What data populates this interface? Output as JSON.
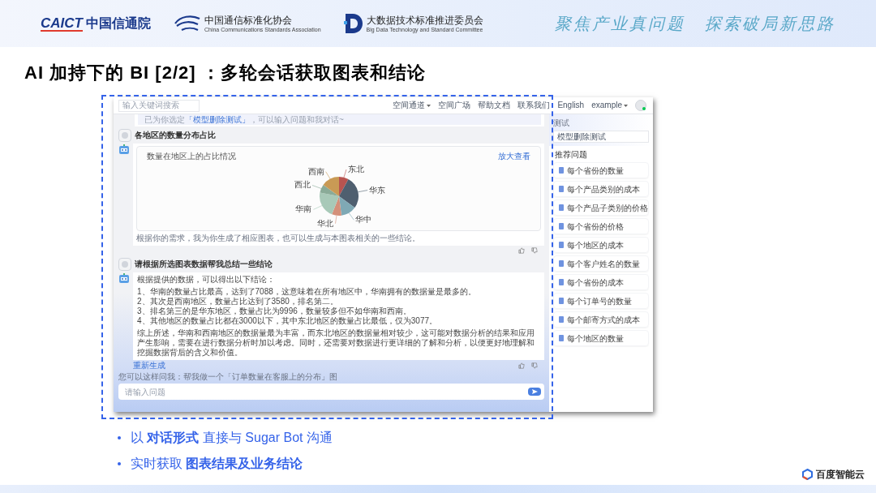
{
  "header": {
    "caict": {
      "mark": "CAICT",
      "name": "中国信通院"
    },
    "ccsa": {
      "name": "中国通信标准化协会",
      "english": "China Communications Standards Association"
    },
    "bdc": {
      "name": "大数据技术标准推进委员会",
      "english": "Big Data Technology and Standard Committee"
    },
    "slogan": [
      "聚焦产业真问题",
      "探索破局新思路"
    ]
  },
  "title": "AI 加持下的 BI [2/2] ：多轮会话获取图表和结论",
  "app": {
    "search": {
      "placeholder": "输入关键词搜索"
    },
    "nav": [
      {
        "label": "空间通道",
        "dropdown": true
      },
      {
        "label": "空间广场",
        "dropdown": false
      },
      {
        "label": "帮助文档",
        "dropdown": false
      },
      {
        "label": "联系我们",
        "dropdown": false
      },
      {
        "label": "English",
        "dropdown": false
      },
      {
        "label": "example",
        "dropdown": true
      }
    ],
    "intro": {
      "before": "已为你选定",
      "link": "「模型删除测试」",
      "after": "，可以输入问题和我对话~"
    },
    "messages": [
      {
        "kind": "user",
        "text": "各地区的数量分布占比"
      },
      {
        "kind": "chart",
        "title": "数量在地区上的占比情况",
        "action": "放大查看",
        "slices": [
          {
            "label": "东北",
            "color": "#b85450"
          },
          {
            "label": "华东",
            "color": "#4f5f6f"
          },
          {
            "label": "华中",
            "color": "#7fa9b5"
          },
          {
            "label": "华北",
            "color": "#d4907a"
          },
          {
            "label": "华南",
            "color": "#a8c9b8"
          },
          {
            "label": "西北",
            "color": "#8aab98"
          },
          {
            "label": "西南",
            "color": "#c99a55"
          }
        ],
        "caption": "根据你的需求，我为你生成了相应图表，也可以生成与本图表相关的一些结论。"
      },
      {
        "kind": "user",
        "text": "请根据所选图表数据帮我总结一些结论"
      },
      {
        "kind": "answer",
        "intro": "根据提供的数据，可以得出以下结论：",
        "points": [
          "1、华南的数量占比最高，达到了7088，这意味着在所有地区中，华南拥有的数据量是最多的。",
          "2、其次是西南地区，数量占比达到了3580，排名第二。",
          "3、排名第三的是华东地区，数量占比为9996，数量较多但不如华南和西南。",
          "4、其他地区的数量占比都在3000以下，其中东北地区的数量占比最低，仅为3077。"
        ],
        "summary": "综上所述，华南和西南地区的数据量最为丰富，而东北地区的数据量相对较少，这可能对数据分析的结果和应用产生影响，需要在进行数据分析时加以考虑。同时，还需要对数据进行更详细的了解和分析，以便更好地理解和挖掘数据背后的含义和价值。",
        "regenerate": "重新生成"
      }
    ],
    "suggestion": "您可以这样问我：帮我做一个「订单数量在客服上的分布」图",
    "input": {
      "placeholder": "请输入问题"
    },
    "sidebar": {
      "label": "测试",
      "value": "模型删除测试",
      "heading": "推荐问题",
      "items": [
        "每个省份的数量",
        "每个产品类别的成本",
        "每个产品子类别的价格",
        "每个省份的价格",
        "每个地区的成本",
        "每个客户姓名的数量",
        "每个省份的成本",
        "每个订单号的数量",
        "每个邮寄方式的成本",
        "每个地区的数量"
      ]
    }
  },
  "bullets": [
    "以 **对话形式** 直接与 Sugar Bot 沟通",
    "实时获取 **图表结果及业务结论**"
  ],
  "footer_logo": "百度智能云"
}
